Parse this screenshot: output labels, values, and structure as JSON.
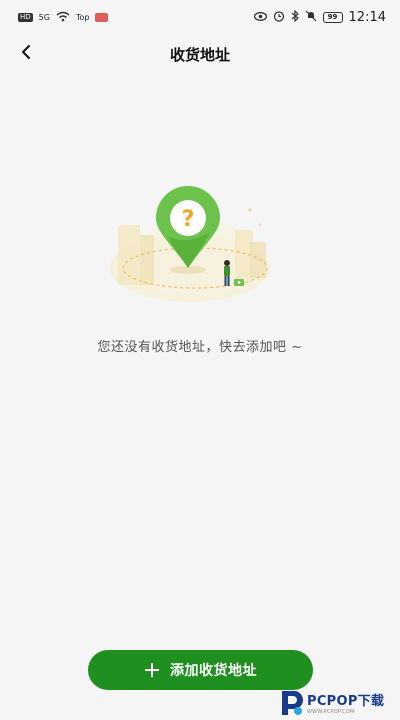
{
  "status_bar": {
    "left_chips": [
      "HD",
      "5G"
    ],
    "network_speed": "Top",
    "battery": "99",
    "time": "12:14"
  },
  "header": {
    "title": "收货地址",
    "back_icon": "chevron-left-icon"
  },
  "empty_state": {
    "message": "您还没有收货地址，快去添加吧 ~",
    "illustration": "map-pin-question-icon"
  },
  "actions": {
    "add_label": "添加收货地址",
    "add_icon": "plus-icon"
  },
  "watermark": {
    "brand": "PCPOP下载",
    "sub": "WWW.PCPOP.COM"
  },
  "colors": {
    "primary_green": "#1f8f1f",
    "pin_green": "#6cc24a",
    "question_orange": "#f2a521",
    "background": "#f5f5f5"
  }
}
